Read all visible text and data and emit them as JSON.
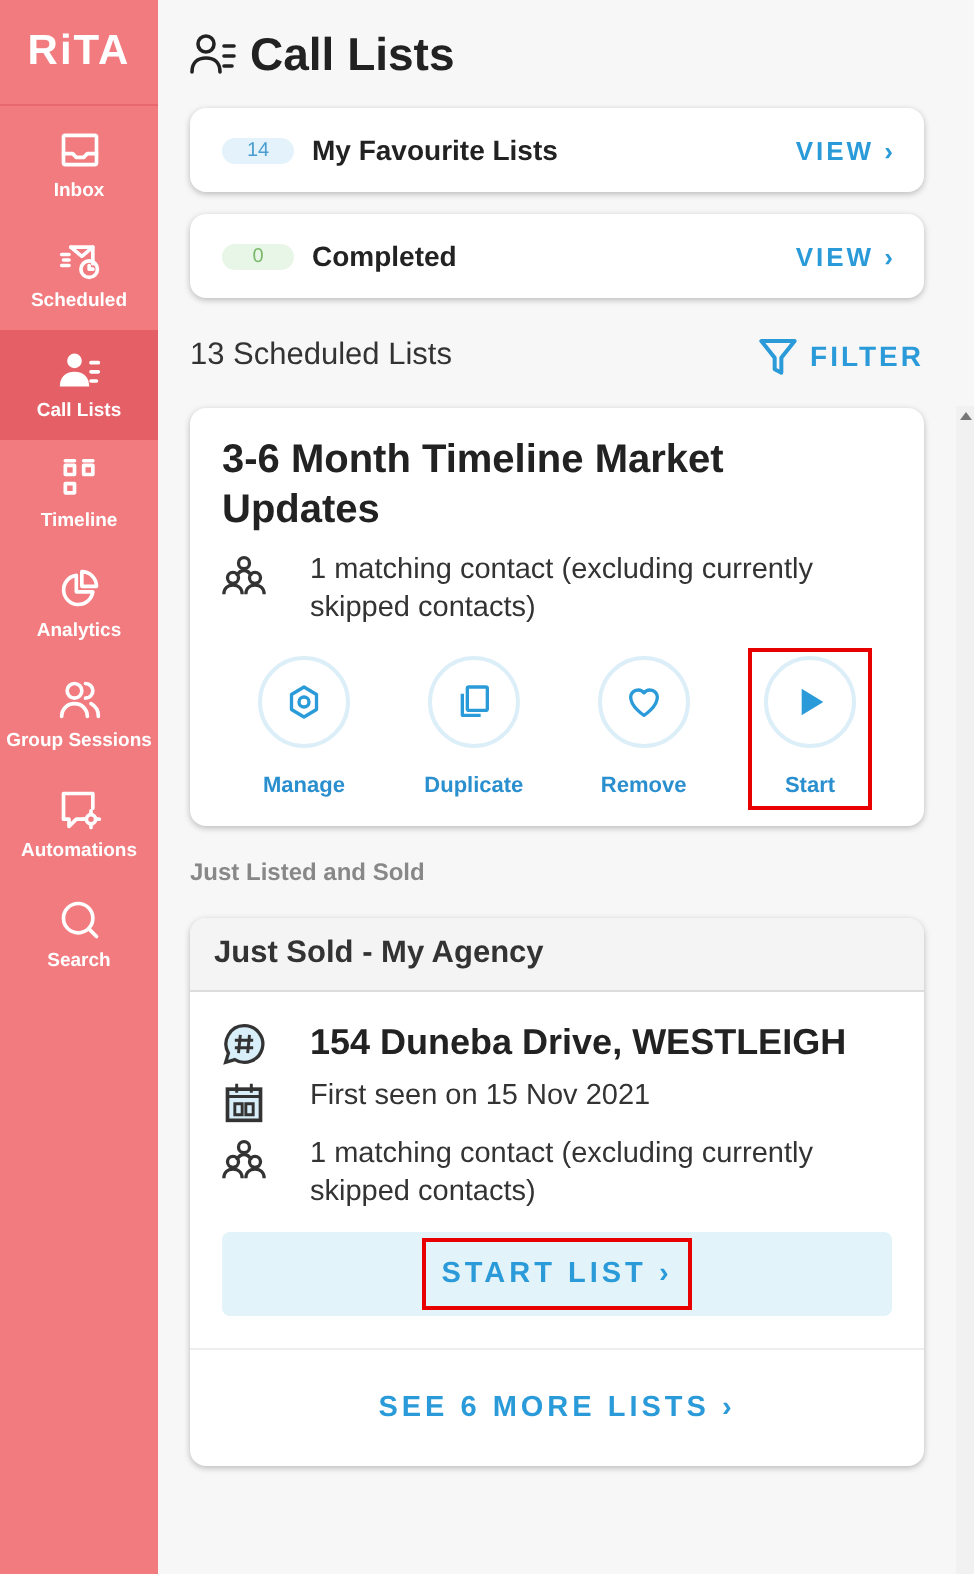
{
  "sidebar": {
    "logo": "RiTA",
    "items": [
      {
        "kind": "inbox",
        "label": "Inbox",
        "selected": false
      },
      {
        "kind": "scheduled",
        "label": "Scheduled",
        "selected": false
      },
      {
        "kind": "call-lists",
        "label": "Call Lists",
        "selected": true
      },
      {
        "kind": "timeline",
        "label": "Timeline",
        "selected": false
      },
      {
        "kind": "analytics",
        "label": "Analytics",
        "selected": false
      },
      {
        "kind": "group-sessions",
        "label": "Group Sessions",
        "selected": false
      },
      {
        "kind": "automations",
        "label": "Automations",
        "selected": false
      },
      {
        "kind": "search",
        "label": "Search",
        "selected": false
      }
    ]
  },
  "header": {
    "title": "Call Lists"
  },
  "summary_rows": [
    {
      "count": "14",
      "color": "#e3f2fb",
      "label": "My Favourite Lists",
      "action": "VIEW ›"
    },
    {
      "count": "0",
      "color": "#e8f6e8",
      "label": "Completed",
      "action": "VIEW ›"
    }
  ],
  "scheduled": {
    "count_label": "13 Scheduled Lists",
    "filter": "FILTER"
  },
  "list_card": {
    "title": "3-6 Month Timeline Market Updates",
    "contacts": "1 matching contact (excluding currently skipped contacts)",
    "actions": [
      {
        "kind": "manage",
        "label": "Manage",
        "highlighted": false
      },
      {
        "kind": "duplicate",
        "label": "Duplicate",
        "highlighted": false
      },
      {
        "kind": "remove",
        "label": "Remove",
        "highlighted": false
      },
      {
        "kind": "start",
        "label": "Start",
        "highlighted": true
      }
    ]
  },
  "group": {
    "heading": "Just Listed and Sold",
    "card_title": "Just Sold - My Agency",
    "address": "154 Duneba Drive, WESTLEIGH",
    "first_seen": "First seen on 15 Nov 2021",
    "contacts": "1 matching contact (excluding currently skipped contacts)",
    "start_button": {
      "label": "START LIST ›",
      "highlighted": true
    },
    "more": "SEE 6 MORE LISTS ›"
  }
}
